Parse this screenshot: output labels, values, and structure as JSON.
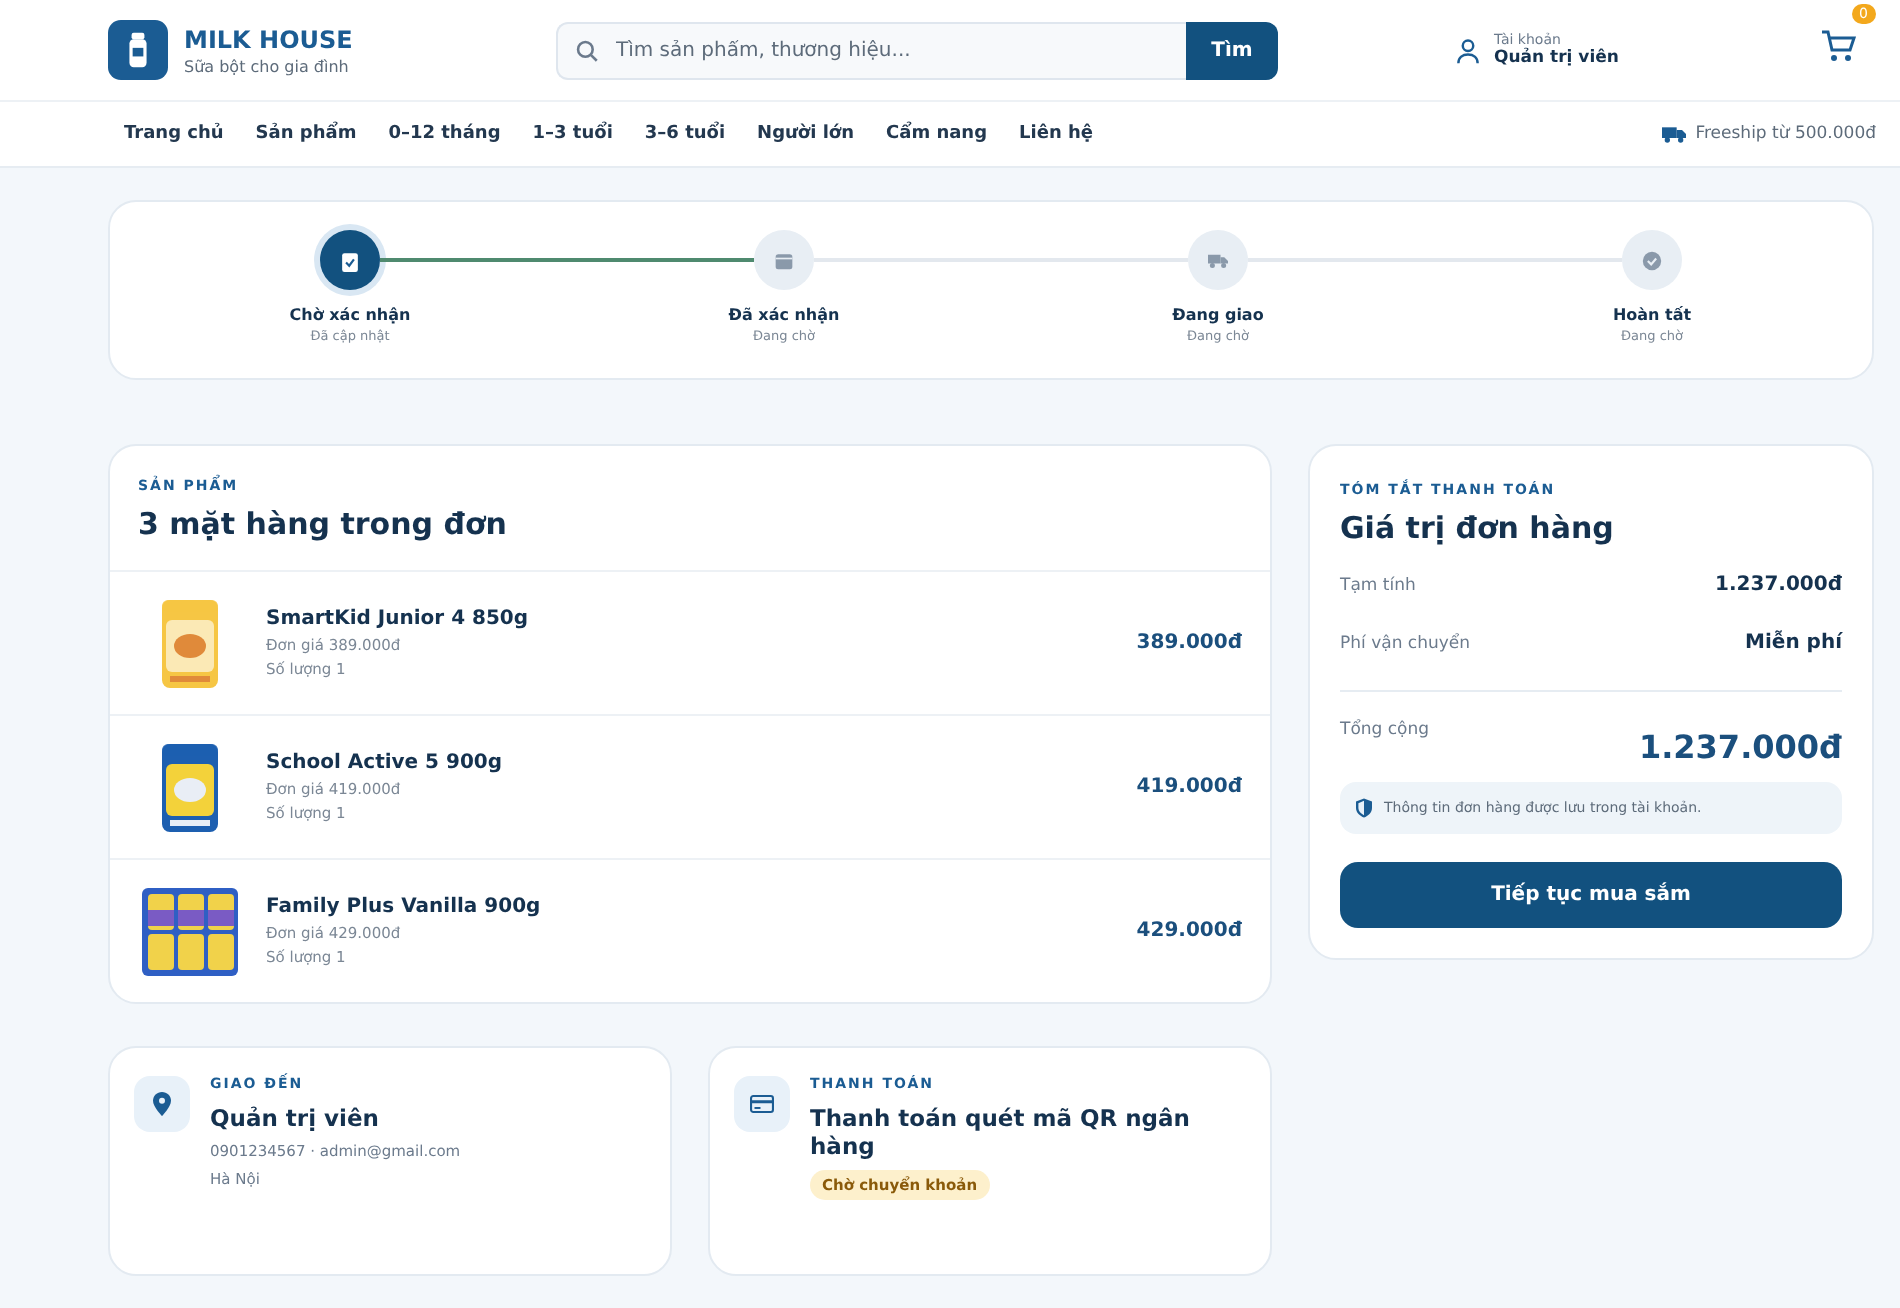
{
  "header": {
    "brand": "MILK HOUSE",
    "tagline": "Sữa bột cho gia đình",
    "search": {
      "placeholder": "Tìm sản phẩm, thương hiệu...",
      "button": "Tìm"
    },
    "account": {
      "label": "Tài khoản",
      "name": "Quản trị viên"
    },
    "cart": {
      "count": "0"
    }
  },
  "nav": {
    "items": [
      {
        "label": "Trang chủ"
      },
      {
        "label": "Sản phẩm"
      },
      {
        "label": "0–12 tháng"
      },
      {
        "label": "1–3 tuổi"
      },
      {
        "label": "3–6 tuổi"
      },
      {
        "label": "Người lớn"
      },
      {
        "label": "Cẩm nang"
      },
      {
        "label": "Liên hệ"
      }
    ],
    "freeship": "Freeship từ 500.000đ"
  },
  "steps": [
    {
      "kind": "clipboard",
      "title": "Chờ xác nhận",
      "note": "Đã cập nhật",
      "selected": true
    },
    {
      "kind": "box",
      "title": "Đã xác nhận",
      "note": "Đang chờ",
      "selected": false
    },
    {
      "kind": "truck",
      "title": "Đang giao",
      "note": "Đang chờ",
      "selected": false
    },
    {
      "kind": "check",
      "title": "Hoàn tất",
      "note": "Đang chờ",
      "selected": false
    }
  ],
  "connectors": [
    {
      "done": true
    },
    {
      "done": false
    },
    {
      "done": false
    }
  ],
  "products": {
    "eyebrow": "SẢN PHẨM",
    "title": "3 mặt hàng trong đơn",
    "items": [
      {
        "name": "SmartKid Junior 4 850g",
        "unit_price": "Đơn giá 389.000đ",
        "quantity": "Số lượng 1",
        "total": "389.000đ",
        "kind": "picture"
      },
      {
        "name": "School Active 5 900g",
        "unit_price": "Đơn giá 419.000đ",
        "quantity": "Số lượng 1",
        "total": "419.000đ",
        "kind": "picture"
      },
      {
        "name": "Family Plus Vanilla 900g",
        "unit_price": "Đơn giá 429.000đ",
        "quantity": "Số lượng 1",
        "total": "429.000đ",
        "kind": "picture"
      }
    ]
  },
  "summary": {
    "eyebrow": "TÓM TẮT THANH TOÁN",
    "title": "Giá trị đơn hàng",
    "rows": [
      {
        "label": "Tạm tính",
        "value": "1.237.000đ"
      },
      {
        "label": "Phí vận chuyển",
        "value": "Miễn phí"
      }
    ],
    "total_label": "Tổng cộng",
    "total": "1.237.000đ",
    "note": "Thông tin đơn hàng được lưu trong tài khoản.",
    "button": "Tiếp tục mua sắm"
  },
  "delivery": {
    "eyebrow": "GIAO ĐẾN",
    "name": "Quản trị viên",
    "contact": "0901234567 · admin@gmail.com",
    "address": "Hà Nội"
  },
  "payment": {
    "eyebrow": "THANH TOÁN",
    "method": "Thanh toán quét mã QR ngân hàng",
    "status": "Chờ chuyển khoản"
  }
}
